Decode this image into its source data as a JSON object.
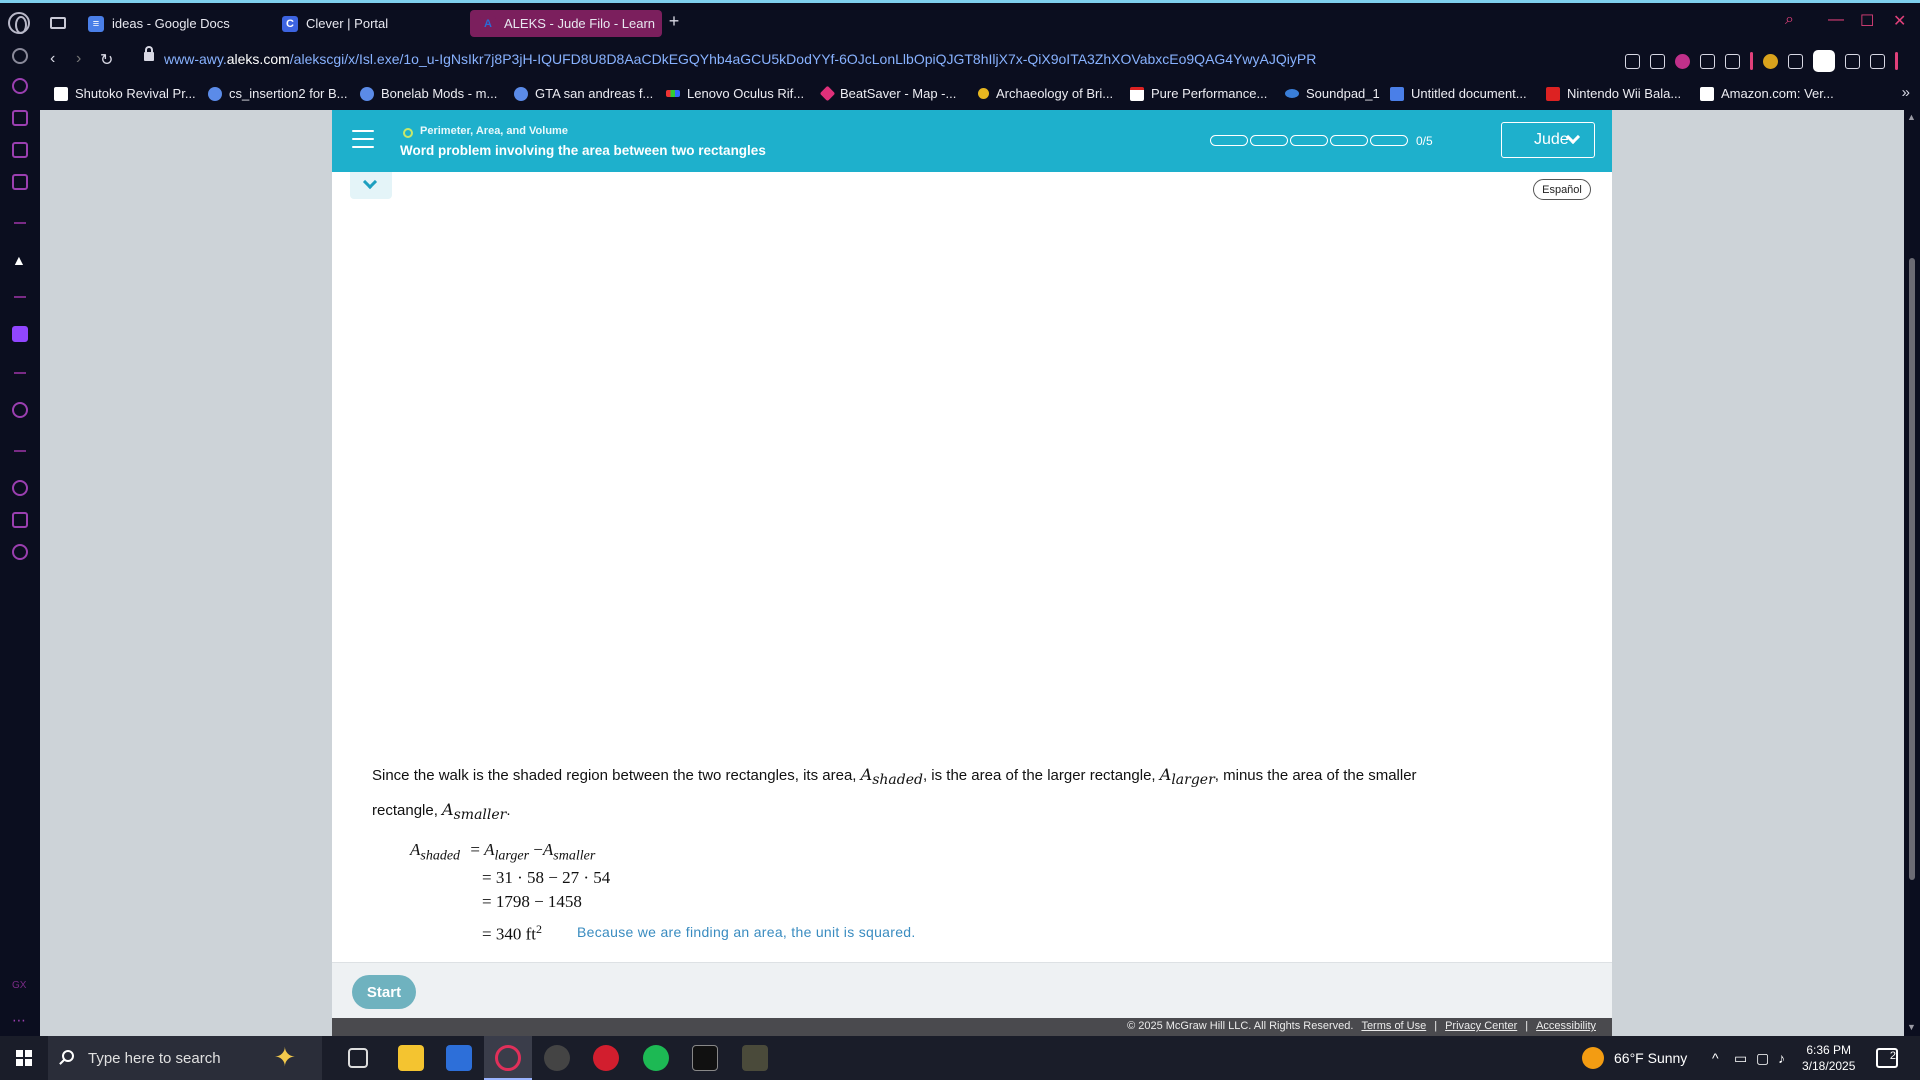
{
  "browser": {
    "tabs": [
      {
        "title": "ideas - Google Docs",
        "icon": "docs-icon",
        "color": "#4a7fe8"
      },
      {
        "title": "Clever | Portal",
        "icon": "clever-icon",
        "color": "#3d64e0"
      },
      {
        "title": "ALEKS - Jude Filo - Learn",
        "icon": "aleks-icon",
        "color": "#7b1f5d",
        "active": true
      }
    ],
    "url_prefix": "www-awy.",
    "url_domain": "aleks.com",
    "url_path": "/alekscgi/x/Isl.exe/1o_u-IgNsIkr7j8P3jH-IQUFD8U8D8AaCDkEGQYhb4aGCU5kDodYYf-6OJcLonLlbOpiQJGT8hIljX7x-QiX9oITA3ZhXOVabxcEo9QAG4YwyAJQiyPR",
    "bookmarks": [
      "Shutoko Revival Pr...",
      "cs_insertion2 for B...",
      "Bonelab Mods - m...",
      "GTA san andreas f...",
      "Lenovo Oculus Rif...",
      "BeatSaver - Map -...",
      "Archaeology of Bri...",
      "Pure Performance...",
      "Soundpad_1",
      "Untitled document...",
      "Nintendo Wii Bala...",
      "Amazon.com: Ver..."
    ]
  },
  "aleks": {
    "topic": "Perimeter, Area, and Volume",
    "subtopic": "Word problem involving the area between two rectangles",
    "progress": {
      "done": 0,
      "total": 5,
      "label": "0/5"
    },
    "user": "Jude",
    "language_button": "Español",
    "start_button": "Start"
  },
  "explanation": {
    "p1": "Since the walk is the shaded region between the two rectangles, its area,",
    "p2": ", is the area of the larger rectangle,",
    "p3": ", minus the area of the smaller",
    "p4": "rectangle,",
    "p5": ".",
    "var_A": "A",
    "sub_shaded": "shaded",
    "sub_larger": "larger",
    "sub_smaller": "smaller",
    "eq1_rhs_minus": "−",
    "eq2": "= 31 · 58 − 27 · 54",
    "eq3": "= 1798 − 1458",
    "eq4": "= 340 ft",
    "eq4_exp": "2",
    "eq_equals": "=",
    "unit_note": "Because we are finding an area, the unit is squared."
  },
  "footer": {
    "copyright": "© 2025 McGraw Hill LLC. All Rights Reserved.",
    "terms": "Terms of Use",
    "privacy": "Privacy Center",
    "accessibility": "Accessibility",
    "sep": "|"
  },
  "taskbar": {
    "search_placeholder": "Type here to search",
    "weather": "66°F  Sunny",
    "time": "6:36 PM",
    "date": "3/18/2025",
    "notifications": "2"
  }
}
